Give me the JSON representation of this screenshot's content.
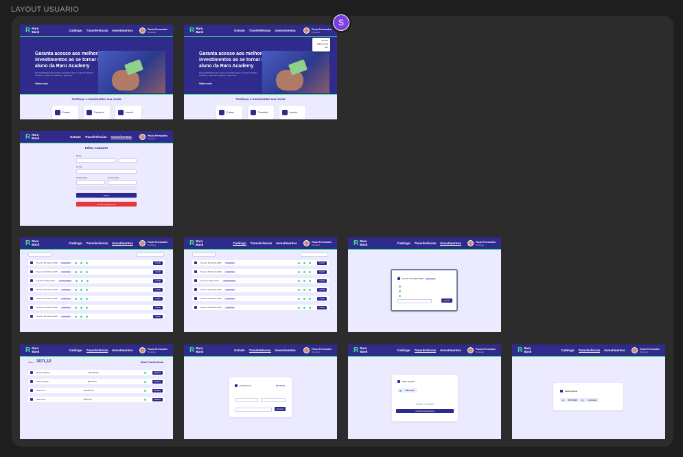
{
  "page": {
    "title": "LAYOUT USUARIO",
    "avatar_letter": "S"
  },
  "brand": {
    "line1": "Raro",
    "line2": "Bank"
  },
  "nav_public": [
    "Catálogo",
    "Transferências",
    "Investimentos"
  ],
  "nav_private": [
    "Extrato",
    "Transferências",
    "Investimentos"
  ],
  "user": {
    "name": "Paulo Fernandes",
    "sub": "Premium"
  },
  "hero": {
    "headline": "Garanta acesso aos melhores investimentos ao se tornar um aluno da Raro Academy",
    "body": "Nossa plataforma de ensino é exclusiva para os alunos da Raro Academy. Faça seu cadastro e aproveite.",
    "cta": "Saiba mais"
  },
  "conheca": "Conheça o movimentar sua conta",
  "tiles": [
    "Extrato",
    "Transferir",
    "Investir"
  ],
  "dropdown": [
    "Extrato",
    "Editar conta",
    "Sair"
  ],
  "edit": {
    "title": "Editar Cadastro",
    "name_label": "Nome",
    "email_label": "E-mail",
    "password_label": "Senha atual",
    "new_password_label": "Nova senha",
    "save": "Salvar",
    "delete": "Excluir minha conta"
  },
  "catalog": {
    "filter_label": "Filtrar por",
    "rows": [
      {
        "name": "Tesouro Pré-fixado 2026",
        "tag": "Renda fixa",
        "action": "Investir"
      },
      {
        "name": "Tesouro Pré-fixado 2026",
        "tag": "Renda fixa",
        "action": "Investir"
      },
      {
        "name": "Fundo de Ações Raro",
        "tag": "Renda variável",
        "action": "Investir"
      },
      {
        "name": "Tesouro Pré-fixado 2026",
        "tag": "Renda fixa",
        "action": "Investir"
      },
      {
        "name": "Tesouro Pré-fixado 2026",
        "tag": "Renda fixa",
        "action": "Investir"
      },
      {
        "name": "Tesouro Pré-fixado 2026",
        "tag": "Renda fixa",
        "action": "Investir"
      },
      {
        "name": "Tesouro Pré-fixado 2026",
        "tag": "Renda fixa",
        "action": "Investir"
      }
    ]
  },
  "modal": {
    "title": "Tesouro Pré-fixado 2026",
    "tag": "Renda fixa",
    "action": "Investir"
  },
  "transfers": {
    "balance_label": "Saldo",
    "balance": "3071,12",
    "new": "Nova Transferência",
    "rows": [
      {
        "name": "Maria Joaquina",
        "value": "- R$ 1000,00",
        "action": "Detalhes"
      },
      {
        "name": "Paulo Augusto",
        "value": "- R$ 150,00",
        "action": "Detalhes"
      },
      {
        "name": "Ana Lúcia",
        "value": "- R$ 1200,00",
        "action": "Detalhes"
      },
      {
        "name": "Ana Lúcia",
        "value": "- R$ 50,00",
        "action": "Detalhes"
      }
    ]
  },
  "transfer_form": {
    "title": "Transferência",
    "amount": "R$ 100,00",
    "button": "Transferir"
  },
  "confirm": {
    "dest": "Paulo Augusto",
    "value": "- R$ 100,00",
    "code_placeholder": "Digite o código",
    "button": "Confirmar transferência"
  },
  "done": {
    "dest": "Paulo Augusto",
    "value": "R$ 100,00",
    "status": "Concluída"
  },
  "colors": {
    "primary": "#2f2b8c",
    "accent": "#3ee08b",
    "danger": "#e53935",
    "bg": "#eceaff"
  }
}
